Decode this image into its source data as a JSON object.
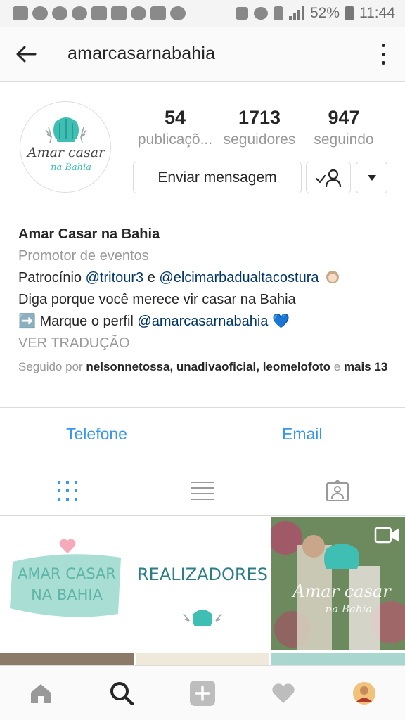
{
  "status_bar": {
    "battery": "52%",
    "time": "11:44"
  },
  "header": {
    "username": "amarcasarnabahia"
  },
  "stats": [
    {
      "value": "54",
      "label": "publicaçõ..."
    },
    {
      "value": "1713",
      "label": "seguidores"
    },
    {
      "value": "947",
      "label": "seguindo"
    }
  ],
  "actions": {
    "message_label": "Enviar mensagem"
  },
  "bio": {
    "name": "Amar Casar na Bahia",
    "category": "Promotor de eventos",
    "line1_prefix": "Patrocínio ",
    "line1_mention1": "@tritour3",
    "line1_mid": " e ",
    "line1_mention2": "@elcimarbadualtacostura",
    "line2": "Diga porque você merece vir casar na Bahia",
    "line3_prefix": "➡️ Marque o perfil ",
    "line3_mention": "@amarcasarnabahia",
    "line3_suffix": " 💙",
    "translate": "VER TRADUÇÃO",
    "followed_prefix": "Seguido por ",
    "followed_users": "nelsonnetossa, unadivaoficial, leomelofoto",
    "followed_and": " e ",
    "followed_more": "mais 13"
  },
  "contact": {
    "phone": "Telefone",
    "email": "Email"
  },
  "logo": {
    "line1": "Amar casar",
    "line2": "na Bahia"
  },
  "grid": {
    "post1_line1": "AMAR CASAR",
    "post1_line2": "NA BAHIA",
    "post2_title": "REALIZADORES",
    "post3_line1": "Amar casar",
    "post3_line2": "na Bahia"
  },
  "colors": {
    "accent": "#3897f0",
    "brand_teal": "#3fbfb3",
    "text": "#262626",
    "muted": "#999999"
  }
}
